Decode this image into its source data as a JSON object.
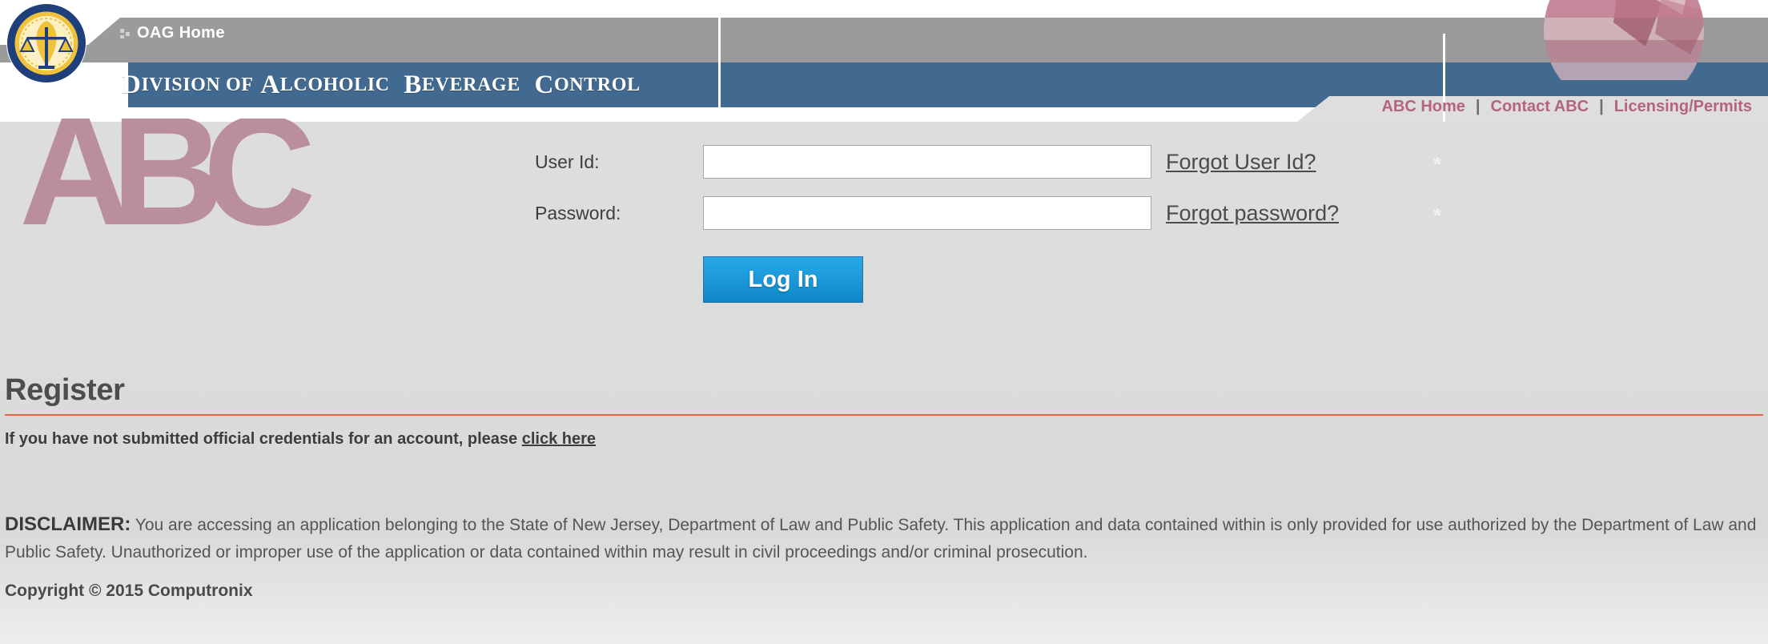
{
  "header": {
    "seal_icon": "nj-attorney-general-seal-icon",
    "flag_icon": "flag-circle-icon",
    "oag_home_label": "OAG Home",
    "oag_bullet_icon": "bullet-arrow-icon",
    "division_title_parts": [
      {
        "cap": "D",
        "rest": "IVISION"
      },
      {
        "cap": " OF",
        "rest": ""
      },
      {
        "cap": " A",
        "rest": "LCOHOLIC"
      },
      {
        "cap": " B",
        "rest": "EVERAGE"
      },
      {
        "cap": " C",
        "rest": "ONTROL"
      }
    ],
    "division_title": "DIVISION OF ALCOHOLIC BEVERAGE CONTROL",
    "nav": [
      {
        "label": "ABC Home"
      },
      {
        "label": "Contact ABC"
      },
      {
        "label": "Licensing/Permits"
      }
    ],
    "nav_separator": "|",
    "colors": {
      "gray_band": "#9b9b9b",
      "blue_band": "#426a90",
      "nav_link": "#b4657c"
    }
  },
  "branding": {
    "abc_logo_text": "ABC",
    "abc_logo_color": "#bb8e9c"
  },
  "login": {
    "user_id_label": "User Id:",
    "user_id_value": "",
    "user_id_placeholder": "",
    "password_label": "Password:",
    "password_value": "",
    "password_placeholder": "",
    "forgot_user_id_label": "Forgot User Id?",
    "forgot_password_label": "Forgot password?",
    "required_marker": "*",
    "login_button_label": "Log In",
    "login_button_color": "#1e9ada"
  },
  "register": {
    "heading": "Register",
    "rule_color": "#e8643c",
    "text_before": "If you have not submitted official credentials for an account, please ",
    "link_label": "click here"
  },
  "disclaimer": {
    "lead": "DISCLAIMER:",
    "body": " You are accessing an application belonging to the State of New Jersey, Department of Law and Public Safety. This application and data contained within is only provided for use authorized by the Department of Law and Public Safety. Unauthorized or improper use of the application or data contained within may result in civil proceedings and/or criminal prosecution."
  },
  "footer": {
    "copyright": "Copyright © 2015 Computronix"
  }
}
